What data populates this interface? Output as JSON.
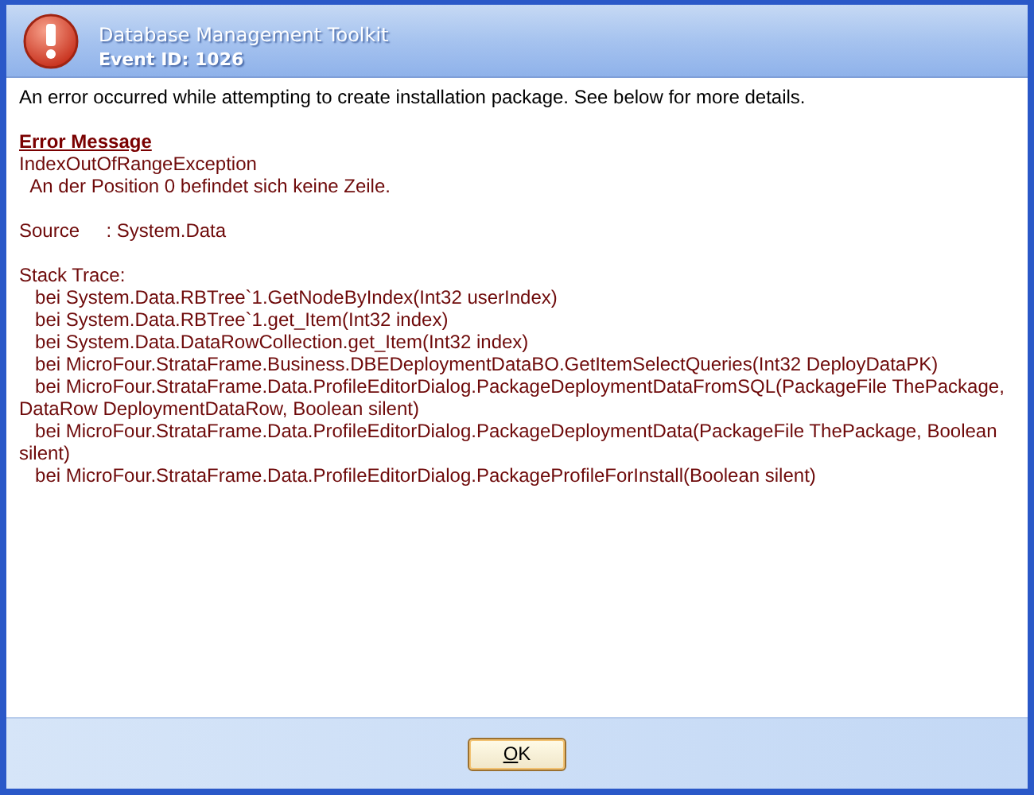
{
  "window": {
    "title": "Database Management Toolkit",
    "subtitle": "Event ID: 1026"
  },
  "message": "An error occurred while attempting to create installation package. See below for more details.",
  "details": {
    "heading": "Error Message",
    "exception": "IndexOutOfRangeException",
    "exception_message": "  An der Position 0 befindet sich keine Zeile.",
    "source": "Source     : System.Data",
    "stack_trace_label": "Stack Trace:",
    "stack_trace": [
      "   bei System.Data.RBTree`1.GetNodeByIndex(Int32 userIndex)",
      "   bei System.Data.RBTree`1.get_Item(Int32 index)",
      "   bei System.Data.DataRowCollection.get_Item(Int32 index)",
      "   bei MicroFour.StrataFrame.Business.DBEDeploymentDataBO.GetItemSelectQueries(Int32 DeployDataPK)",
      "   bei MicroFour.StrataFrame.Data.ProfileEditorDialog.PackageDeploymentDataFromSQL(PackageFile ThePackage, DataRow DeploymentDataRow, Boolean silent)",
      "   bei MicroFour.StrataFrame.Data.ProfileEditorDialog.PackageDeploymentData(PackageFile ThePackage, Boolean silent)",
      "   bei MicroFour.StrataFrame.Data.ProfileEditorDialog.PackageProfileForInstall(Boolean silent)"
    ]
  },
  "buttons": [
    "OK"
  ]
}
